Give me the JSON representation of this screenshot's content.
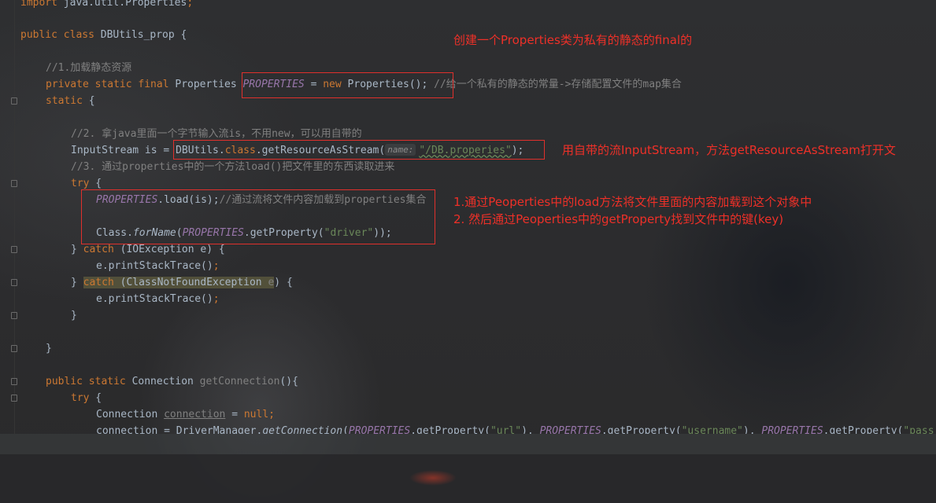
{
  "code_lines": [
    {
      "type": "plain",
      "text": "import java.util.Properties;"
    },
    {
      "type": "classdecl",
      "kw": "public class ",
      "name": "DBUtils_prop",
      "rest": " {"
    },
    {
      "type": "comment",
      "text": "//1.加载静态资源"
    },
    {
      "type": "field",
      "kw": "private static final ",
      "type_name": "Properties ",
      "fieldName": "PROPERTIES",
      "eq": " = ",
      "kw2": "new ",
      "ctor": "Properties();",
      "comment": " //给一个私有的静态的常量->存储配置文件的map集合"
    },
    {
      "type": "static",
      "kw": "static",
      "rest": " {"
    },
    {
      "type": "comment",
      "text": "//2. 拿java里面一个字节输入流is，不用new，可以用自带的"
    },
    {
      "type": "stream",
      "pre": "InputStream is = ",
      "cls": "DBUtils",
      "dot": ".",
      "kw": "class",
      "call": ".getResourceAsStream(",
      "hint": "name:",
      "str": "\"/DB.properies\"",
      "end": ");"
    },
    {
      "type": "comment",
      "text": "//3. 通过properties中的一个方法load()把文件里的东西读取进来"
    },
    {
      "type": "try",
      "kw": "try",
      "rest": " {"
    },
    {
      "type": "load",
      "field": "PROPERTIES",
      "call": ".load(is);",
      "comment": "//通过流将文件内容加载到properties集合"
    },
    {
      "type": "forname",
      "cls": "Class.",
      "method": "forName",
      "open": "(",
      "field": "PROPERTIES",
      "call": ".getProperty(",
      "str": "\"driver\"",
      "end": "));"
    },
    {
      "type": "catch1",
      "pre": "} ",
      "kw": "catch",
      "rest": " (IOException e) {"
    },
    {
      "type": "stmt",
      "text": "e.printStackTrace();"
    },
    {
      "type": "catch2",
      "pre": "} ",
      "kw": "catch",
      "rest": " (ClassNotFoundException ",
      "var": "e",
      ") ": "",
      "close": ") {"
    },
    {
      "type": "stmt",
      "text": "e.printStackTrace();"
    },
    {
      "type": "brace",
      "text": "}"
    },
    {
      "type": "brace",
      "text": "}"
    },
    {
      "type": "method",
      "kw": "public static ",
      "ret": "Connection ",
      "name": "getConnection",
      "rest": "(){"
    },
    {
      "type": "try",
      "kw": "try",
      "rest": " {"
    },
    {
      "type": "conn",
      "pre": "Connection ",
      "var": "connection",
      "eq": " = ",
      "kw": "null",
      ";": "",
      "semi": ";"
    },
    {
      "type": "dm",
      "var": "connection",
      "eq": " = DriverManager.",
      "m": "getConnection",
      "open": "(",
      "f1": "PROPERTIES",
      "c1": ".getProperty(",
      "s1": "\"url\"",
      "sep1": "), ",
      "f2": "PROPERTIES",
      "c2": ".getProperty(",
      "s2": "\"username\"",
      "sep2": "), ",
      "f3": "PROPERTIES",
      "c3": ".getProperty(",
      "s3": "\"pass"
    }
  ],
  "annotations": {
    "note1": "创建一个Properties类为私有的静态的final的",
    "note2": "用自带的流InputStream，方法getResourceAsStream打开文",
    "note3a": "1.通过Peoperties中的load方法将文件里面的内容加载到这个对象中",
    "note3b": "2. 然后通过Peoperties中的getProperty找到文件中的键(key)"
  },
  "colors": {
    "keyword": "#cc7832",
    "comment": "#808080",
    "string": "#6a8759",
    "field": "#9876aa",
    "default": "#a9b7c6",
    "annotation": "#ee3028"
  }
}
